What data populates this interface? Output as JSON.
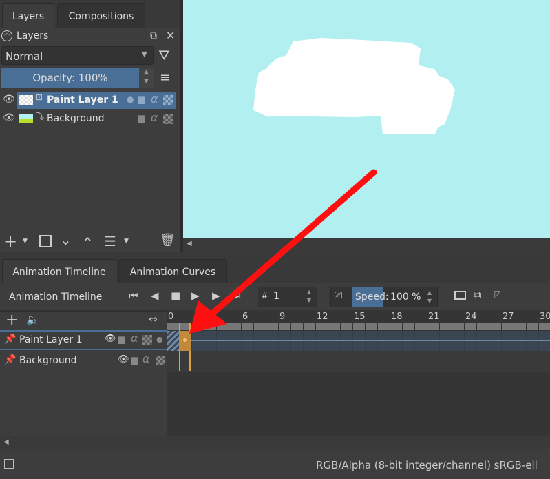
{
  "layers_docker": {
    "tabs": [
      {
        "label": "Layers"
      },
      {
        "label": "Compositions"
      }
    ],
    "title": "Layers",
    "blend_mode": "Normal",
    "opacity": "Opacity:  100%",
    "layers": [
      {
        "name": "Paint Layer 1",
        "selected": true
      },
      {
        "name": "Background",
        "selected": false
      }
    ]
  },
  "animation_docker": {
    "tabs": [
      {
        "label": "Animation Timeline"
      },
      {
        "label": "Animation Curves"
      }
    ],
    "title": "Animation Timeline",
    "frame_prefix": "#",
    "frame_value": "1",
    "speed_label": "Speed:",
    "speed_value": "100 %",
    "ruler": [
      "0",
      "6",
      "9",
      "12",
      "15",
      "18",
      "21",
      "24",
      "27",
      "30"
    ],
    "layers": [
      {
        "name": "Paint Layer 1"
      },
      {
        "name": "Background"
      }
    ],
    "current_frame": 1
  },
  "statusbar": {
    "color_info": "RGB/Alpha (8-bit integer/channel)  sRGB-ell"
  },
  "colors": {
    "canvas": "#b2eff0",
    "selection": "#4a6f96",
    "keyframe": "#e0a040",
    "arrow": "#ff1010"
  }
}
